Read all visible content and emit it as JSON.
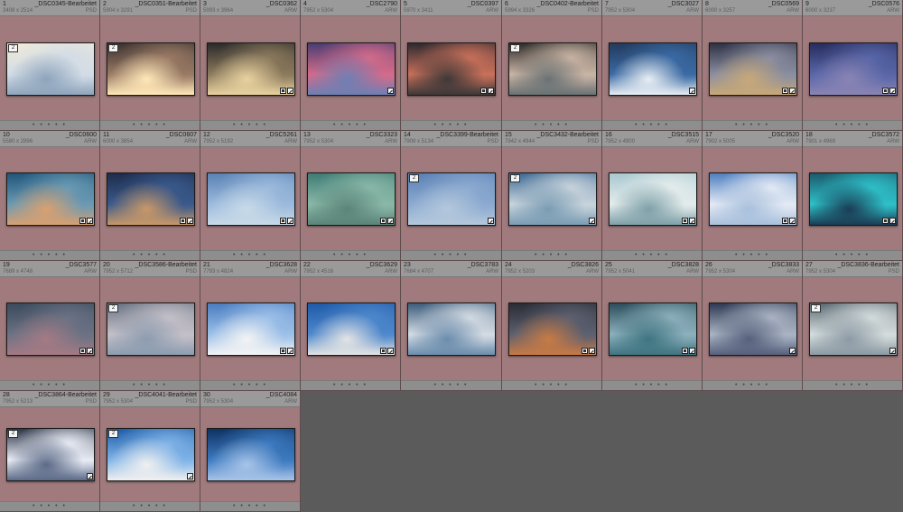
{
  "app": {
    "view": "Grid",
    "cell_footer_dots": "• • • • •"
  },
  "thumbnails": [
    {
      "index": "1",
      "file": "_DSC0345-Bearbeitet",
      "dims": "3408 x 2514",
      "ext": "PSD",
      "stack": "2",
      "icons": [],
      "colors": [
        "#f0ead8",
        "#d2dce6",
        "#8ea4bc"
      ]
    },
    {
      "index": "2",
      "file": "_DSC0351-Bearbeitet",
      "dims": "5904 x 3291",
      "ext": "PSD",
      "stack": "2",
      "icons": [],
      "colors": [
        "#3b3230",
        "#9a7a64",
        "#ffe8b8"
      ]
    },
    {
      "index": "3",
      "file": "_DSC0362",
      "dims": "5993 x 3964",
      "ext": "ARW",
      "stack": "",
      "icons": [
        "metadata",
        "crop"
      ],
      "colors": [
        "#2b2b2b",
        "#8c7a5c",
        "#e8d2a0"
      ]
    },
    {
      "index": "4",
      "file": "_DSC2790",
      "dims": "7952 x 5304",
      "ext": "ARW",
      "stack": "",
      "icons": [
        "crop"
      ],
      "colors": [
        "#4a3e72",
        "#d36b8a",
        "#6d7fb4"
      ]
    },
    {
      "index": "5",
      "file": "_DSC0397",
      "dims": "5970 x 3411",
      "ext": "ARW",
      "stack": "",
      "icons": [
        "metadata",
        "crop"
      ],
      "colors": [
        "#2e2a30",
        "#c8705a",
        "#3e3838"
      ]
    },
    {
      "index": "6",
      "file": "_DSC0402-Bearbeitet",
      "dims": "5994 x 3326",
      "ext": "PSD",
      "stack": "2",
      "icons": [],
      "colors": [
        "#2e2c2a",
        "#c9b4a4",
        "#6a7274"
      ]
    },
    {
      "index": "7",
      "file": "_DSC3027",
      "dims": "7952 x 5304",
      "ext": "ARW",
      "stack": "",
      "icons": [
        "crop"
      ],
      "colors": [
        "#233a5c",
        "#3a6aa4",
        "#e8eef4"
      ]
    },
    {
      "index": "8",
      "file": "_DSC0569",
      "dims": "6000 x 3257",
      "ext": "ARW",
      "stack": "",
      "icons": [
        "metadata",
        "crop"
      ],
      "colors": [
        "#2e3244",
        "#8a8ea0",
        "#c8a878"
      ]
    },
    {
      "index": "9",
      "file": "_DSC0576",
      "dims": "6000 x 3237",
      "ext": "ARW",
      "stack": "",
      "icons": [
        "metadata",
        "crop"
      ],
      "colors": [
        "#272c5c",
        "#5866a8",
        "#8a84b4"
      ]
    },
    {
      "index": "10",
      "file": "_DSC0600",
      "dims": "5580 x 2896",
      "ext": "ARW",
      "stack": "",
      "icons": [
        "metadata",
        "crop"
      ],
      "colors": [
        "#21567a",
        "#6a9ab4",
        "#d8a070"
      ]
    },
    {
      "index": "11",
      "file": "_DSC0607",
      "dims": "6000 x 3854",
      "ext": "ARW",
      "stack": "",
      "icons": [
        "metadata",
        "crop"
      ],
      "colors": [
        "#1e2c4c",
        "#3a5a8c",
        "#c89868"
      ]
    },
    {
      "index": "12",
      "file": "_DSC5261",
      "dims": "7952 x 5192",
      "ext": "ARW",
      "stack": "",
      "icons": [
        "metadata",
        "crop"
      ],
      "colors": [
        "#5a82b4",
        "#9cbadc",
        "#c8dae8"
      ]
    },
    {
      "index": "13",
      "file": "_DSC3323",
      "dims": "7952 x 5304",
      "ext": "ARW",
      "stack": "",
      "icons": [
        "metadata",
        "crop"
      ],
      "colors": [
        "#3e7c74",
        "#8ab8a8",
        "#5a8478"
      ]
    },
    {
      "index": "14",
      "file": "_DSC3399-Bearbeitet",
      "dims": "7908 x 5134",
      "ext": "PSD",
      "stack": "2",
      "icons": [
        "crop"
      ],
      "colors": [
        "#5a80b4",
        "#8caad0",
        "#b4c8dc"
      ]
    },
    {
      "index": "15",
      "file": "_DSC3432-Bearbeitet",
      "dims": "7942 x 4944",
      "ext": "PSD",
      "stack": "2",
      "icons": [
        "crop"
      ],
      "colors": [
        "#3e6a94",
        "#c8d4dc",
        "#7a9cb4"
      ]
    },
    {
      "index": "16",
      "file": "_DSC3515",
      "dims": "7952 x 4900",
      "ext": "ARW",
      "stack": "",
      "icons": [
        "metadata",
        "crop"
      ],
      "colors": [
        "#a8c8d0",
        "#e4ecec",
        "#7ea0a8"
      ]
    },
    {
      "index": "17",
      "file": "_DSC3520",
      "dims": "7902 x 5005",
      "ext": "ARW",
      "stack": "",
      "icons": [
        "metadata",
        "crop"
      ],
      "colors": [
        "#4e80c0",
        "#e4eaf4",
        "#a8c0dc"
      ]
    },
    {
      "index": "18",
      "file": "_DSC3572",
      "dims": "7901 x 4969",
      "ext": "ARW",
      "stack": "",
      "icons": [
        "metadata",
        "crop"
      ],
      "colors": [
        "#1c5a6c",
        "#2ec0c8",
        "#1a3c54"
      ]
    },
    {
      "index": "19",
      "file": "_DSC3577",
      "dims": "7689 x 4748",
      "ext": "ARW",
      "stack": "",
      "icons": [
        "metadata",
        "crop"
      ],
      "colors": [
        "#3a4a5c",
        "#6a7284",
        "#a47a84"
      ]
    },
    {
      "index": "20",
      "file": "_DSC3586-Bearbeitet",
      "dims": "7952 x 5712",
      "ext": "PSD",
      "stack": "2",
      "icons": [],
      "colors": [
        "#6a7484",
        "#c4c0c8",
        "#8c9cb0"
      ]
    },
    {
      "index": "21",
      "file": "_DSC3628",
      "dims": "7793 x 4824",
      "ext": "ARW",
      "stack": "",
      "icons": [
        "metadata",
        "crop"
      ],
      "colors": [
        "#4a7cc0",
        "#9cc0e8",
        "#f4f4f4"
      ]
    },
    {
      "index": "22",
      "file": "_DSC3629",
      "dims": "7952 x 4516",
      "ext": "ARW",
      "stack": "",
      "icons": [
        "metadata",
        "crop"
      ],
      "colors": [
        "#1e5aa8",
        "#4e88cc",
        "#e4e4e4"
      ]
    },
    {
      "index": "23",
      "file": "_DSC3783",
      "dims": "7684 x 4707",
      "ext": "ARW",
      "stack": "",
      "icons": [],
      "colors": [
        "#3c5c7c",
        "#d4dce4",
        "#6a8cac"
      ]
    },
    {
      "index": "24",
      "file": "_DSC3826",
      "dims": "7952 x 5203",
      "ext": "ARW",
      "stack": "",
      "icons": [
        "metadata",
        "crop"
      ],
      "colors": [
        "#2a2c34",
        "#5c6070",
        "#c87a44"
      ]
    },
    {
      "index": "25",
      "file": "_DSC3828",
      "dims": "7952 x 5041",
      "ext": "ARW",
      "stack": "",
      "icons": [
        "metadata",
        "crop"
      ],
      "colors": [
        "#2c4e5c",
        "#8cb0bc",
        "#3e7480"
      ]
    },
    {
      "index": "26",
      "file": "_DSC3833",
      "dims": "7952 x 5304",
      "ext": "ARW",
      "stack": "",
      "icons": [
        "crop"
      ],
      "colors": [
        "#2e3a54",
        "#aab4c4",
        "#56607c"
      ]
    },
    {
      "index": "27",
      "file": "_DSC3836-Bearbeitet",
      "dims": "7952 x 5304",
      "ext": "PSD",
      "stack": "2",
      "icons": [
        "crop"
      ],
      "colors": [
        "#5c6a74",
        "#d4dcdc",
        "#8c9aa4"
      ]
    },
    {
      "index": "28",
      "file": "_DSC3864-Bearbeitet",
      "dims": "7952 x 5213",
      "ext": "PSD",
      "stack": "2",
      "icons": [
        "crop"
      ],
      "colors": [
        "#2c3448",
        "#e8ecf4",
        "#5c6a88"
      ]
    },
    {
      "index": "29",
      "file": "_DSC4041-Bearbeitet",
      "dims": "7952 x 5304",
      "ext": "PSD",
      "stack": "2",
      "icons": [
        "crop"
      ],
      "colors": [
        "#1e5ca8",
        "#80b4e8",
        "#f0f0f0"
      ]
    },
    {
      "index": "30",
      "file": "_DSC4084",
      "dims": "7952 x 5304",
      "ext": "ARW",
      "stack": "",
      "icons": [],
      "colors": [
        "#0e3262",
        "#3c7ac0",
        "#a8c4e8"
      ]
    }
  ]
}
